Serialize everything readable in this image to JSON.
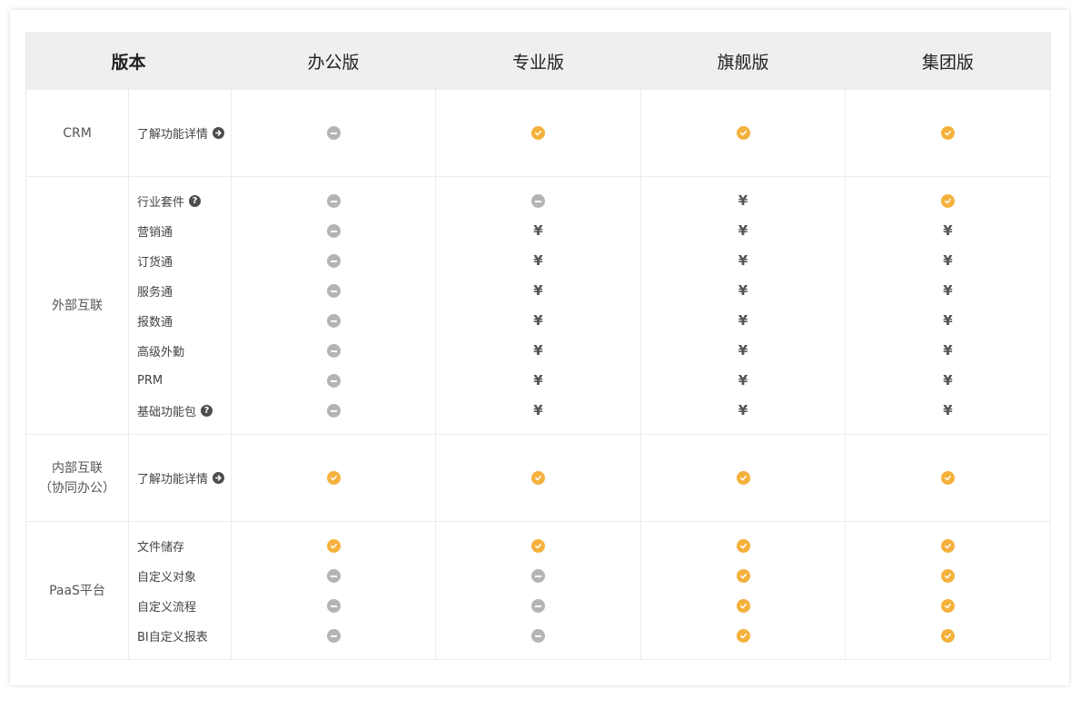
{
  "header": {
    "version_label": "版本",
    "editions": [
      "办公版",
      "专业版",
      "旗舰版",
      "集团版"
    ]
  },
  "legend": {
    "check": "check-circle-icon",
    "minus": "minus-circle-icon",
    "paid_symbol": "¥"
  },
  "colors": {
    "check": "#f4b13c",
    "minus": "#b4b4b4",
    "header_bg": "#efefef"
  },
  "groups": [
    {
      "category": [
        "CRM"
      ],
      "features": [
        {
          "label": "了解功能详情",
          "icon": "arrow-right-circle-icon",
          "values": [
            "minus",
            "check",
            "check",
            "check"
          ]
        }
      ]
    },
    {
      "category": [
        "外部互联"
      ],
      "features": [
        {
          "label": "行业套件",
          "icon": "help-icon",
          "values": [
            "minus",
            "minus",
            "paid",
            "check"
          ]
        },
        {
          "label": "营销通",
          "values": [
            "minus",
            "paid",
            "paid",
            "paid"
          ]
        },
        {
          "label": "订货通",
          "values": [
            "minus",
            "paid",
            "paid",
            "paid"
          ]
        },
        {
          "label": "服务通",
          "values": [
            "minus",
            "paid",
            "paid",
            "paid"
          ]
        },
        {
          "label": "报数通",
          "values": [
            "minus",
            "paid",
            "paid",
            "paid"
          ]
        },
        {
          "label": "高级外勤",
          "values": [
            "minus",
            "paid",
            "paid",
            "paid"
          ]
        },
        {
          "label": "PRM",
          "values": [
            "minus",
            "paid",
            "paid",
            "paid"
          ]
        },
        {
          "label": "基础功能包",
          "icon": "help-icon",
          "values": [
            "minus",
            "paid",
            "paid",
            "paid"
          ]
        }
      ]
    },
    {
      "category": [
        "内部互联",
        "（协同办公）"
      ],
      "features": [
        {
          "label": "了解功能详情",
          "icon": "arrow-right-circle-icon",
          "values": [
            "check",
            "check",
            "check",
            "check"
          ]
        }
      ]
    },
    {
      "category": [
        "PaaS平台"
      ],
      "features": [
        {
          "label": "文件储存",
          "values": [
            "check",
            "check",
            "check",
            "check"
          ]
        },
        {
          "label": "自定义对象",
          "values": [
            "minus",
            "minus",
            "check",
            "check"
          ]
        },
        {
          "label": "自定义流程",
          "values": [
            "minus",
            "minus",
            "check",
            "check"
          ]
        },
        {
          "label": "BI自定义报表",
          "values": [
            "minus",
            "minus",
            "check",
            "check"
          ]
        }
      ]
    }
  ]
}
